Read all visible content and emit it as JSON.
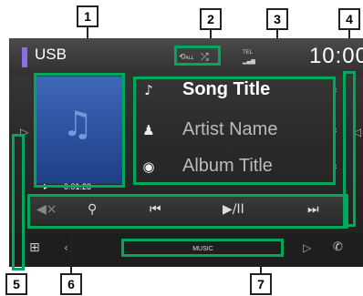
{
  "source": {
    "name": "USB"
  },
  "clock": "10:00",
  "indicators": {
    "repeat": "ALL",
    "tel": "TEL"
  },
  "track": {
    "title": "Song Title",
    "artist": "Artist Name",
    "album": "Album Title",
    "elapsed": "0:01:23"
  },
  "bottom": {
    "label": "MUSIC"
  },
  "callouts": [
    "1",
    "2",
    "3",
    "4",
    "5",
    "6",
    "7"
  ],
  "colors": {
    "annotation": "#00a859",
    "source_strip": "#8c6fe0",
    "artwork": "#2e58a6"
  },
  "icons": {
    "artist": "person-icon",
    "album": "disc-icon",
    "title": "note-icon",
    "controls": [
      "mute-icon",
      "search-icon",
      "previous-icon",
      "play-pause-icon",
      "next-icon"
    ]
  }
}
